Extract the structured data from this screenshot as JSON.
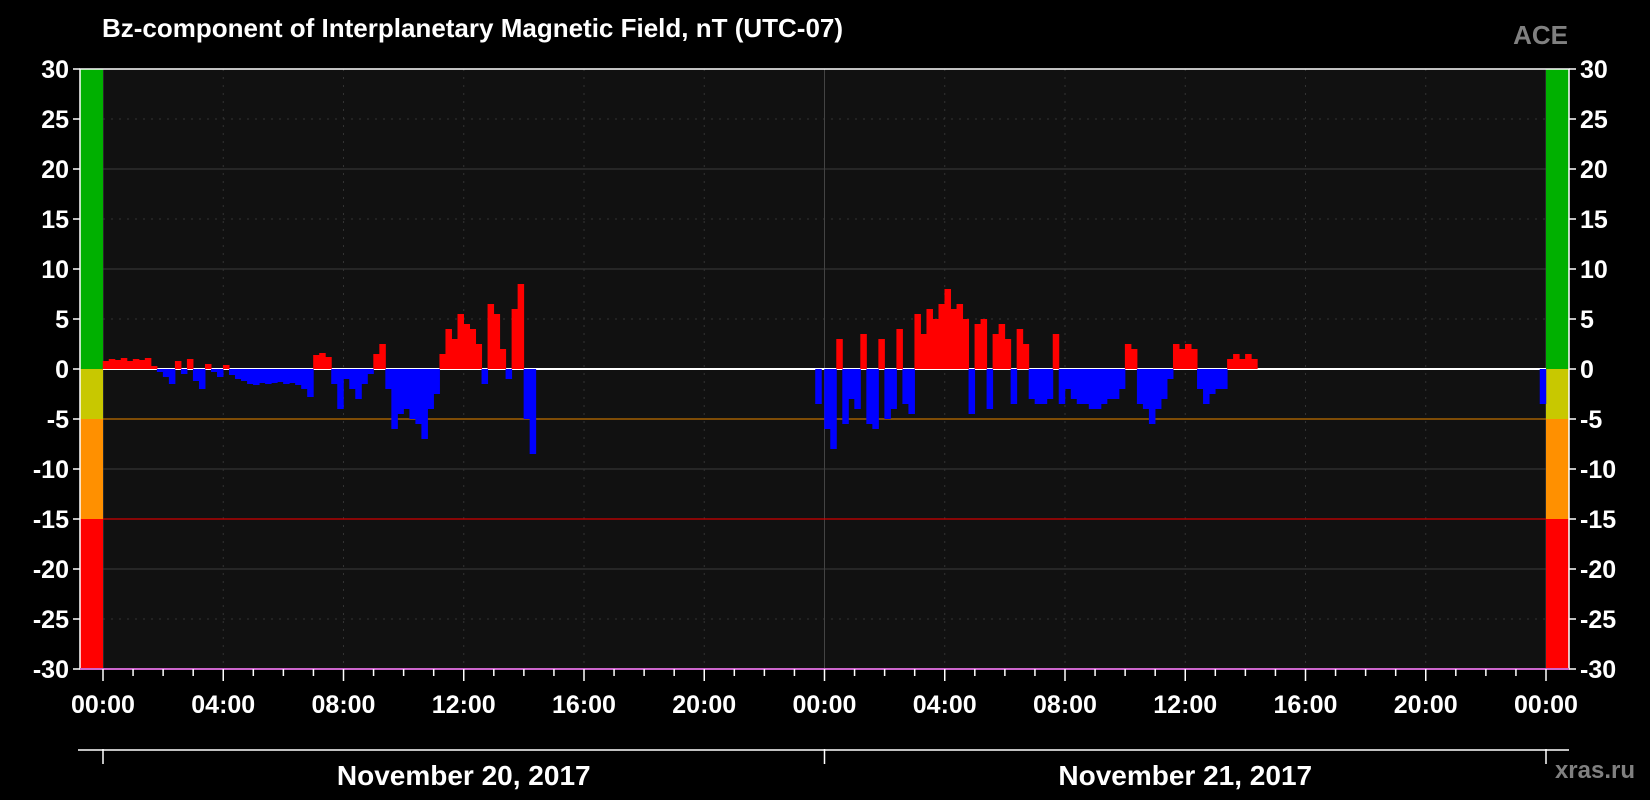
{
  "chart_data": {
    "type": "bar",
    "title": "Bz-component of Interplanetary Magnetic Field, nT (UTC-07)",
    "source_label": "ACE",
    "watermark": "xras.ru",
    "ylim": [
      -30,
      30
    ],
    "y_ticks": [
      30,
      25,
      20,
      15,
      10,
      5,
      0,
      -5,
      -10,
      -15,
      -20,
      -25,
      -30
    ],
    "xlim_hours": [
      0,
      48
    ],
    "x_ticks": [
      {
        "h": 0,
        "label": "00:00"
      },
      {
        "h": 4,
        "label": "04:00"
      },
      {
        "h": 8,
        "label": "08:00"
      },
      {
        "h": 12,
        "label": "12:00"
      },
      {
        "h": 16,
        "label": "16:00"
      },
      {
        "h": 20,
        "label": "20:00"
      },
      {
        "h": 24,
        "label": "00:00"
      },
      {
        "h": 28,
        "label": "04:00"
      },
      {
        "h": 32,
        "label": "08:00"
      },
      {
        "h": 36,
        "label": "12:00"
      },
      {
        "h": 40,
        "label": "16:00"
      },
      {
        "h": 44,
        "label": "20:00"
      },
      {
        "h": 48,
        "label": "00:00"
      }
    ],
    "dates": [
      {
        "label": "November 20, 2017",
        "start_h": 0
      },
      {
        "label": "November 21, 2017",
        "start_h": 24
      }
    ],
    "thresholds": [
      {
        "value": 0,
        "color": "#ffffff"
      },
      {
        "value": -5,
        "color": "#c07000"
      },
      {
        "value": -15,
        "color": "#d00000"
      }
    ],
    "scale_bands": [
      {
        "from": 30,
        "to": 0,
        "color": "#00b000"
      },
      {
        "from": 0,
        "to": -5,
        "color": "#c8c800"
      },
      {
        "from": -5,
        "to": -15,
        "color": "#ff9000"
      },
      {
        "from": -15,
        "to": -30,
        "color": "#ff0000"
      }
    ],
    "colors": {
      "positive": "#ff0000",
      "negative": "#0000ff"
    },
    "series": [
      {
        "x_hours": [
          0.1,
          0.3,
          0.5,
          0.7,
          0.9,
          1.1,
          1.3,
          1.5,
          1.7,
          1.9,
          2.1,
          2.3,
          2.5,
          2.7,
          2.9,
          3.1,
          3.3,
          3.5,
          3.7,
          3.9,
          4.1,
          4.3,
          4.5,
          4.7,
          4.9,
          5.1,
          5.3,
          5.5,
          5.7,
          5.9,
          6.1,
          6.3,
          6.5,
          6.7,
          6.9,
          7.1,
          7.3,
          7.5,
          7.7,
          7.9,
          8.1,
          8.3,
          8.5,
          8.7,
          8.9,
          9.1,
          9.3,
          9.5,
          9.7,
          9.9,
          10.1,
          10.3,
          10.5,
          10.7,
          10.9,
          11.1,
          11.3,
          11.5,
          11.7,
          11.9,
          12.1,
          12.3,
          12.5,
          12.7,
          12.9,
          13.1,
          13.3,
          13.5,
          13.7,
          13.9,
          14.1,
          14.3
        ],
        "values": [
          0.8,
          1.0,
          0.9,
          1.1,
          0.8,
          1.0,
          0.9,
          1.1,
          0.3,
          -0.3,
          -0.8,
          -1.5,
          0.8,
          -0.5,
          1.0,
          -1.2,
          -2.0,
          0.5,
          -0.3,
          -0.8,
          0.4,
          -0.6,
          -1.0,
          -1.2,
          -1.5,
          -1.6,
          -1.4,
          -1.5,
          -1.4,
          -1.3,
          -1.5,
          -1.4,
          -1.6,
          -2.0,
          -2.8,
          1.4,
          1.6,
          1.2,
          -1.5,
          -4.0,
          -1.0,
          -2.0,
          -3.0,
          -1.5,
          -0.5,
          1.5,
          2.5,
          -2.0,
          -6.0,
          -4.5,
          -4.0,
          -5.0,
          -5.5,
          -7.0,
          -4.0,
          -2.5,
          1.5,
          4.0,
          3.0,
          5.5,
          4.5,
          4.0,
          2.5,
          -1.5,
          6.5,
          5.5,
          2.0,
          -1.0,
          6.0,
          8.5,
          -5.0,
          -8.5
        ]
      },
      {
        "x_hours": [
          23.8,
          24.1,
          24.3,
          24.5,
          24.7,
          24.9,
          25.1,
          25.3,
          25.5,
          25.7,
          25.9,
          26.1,
          26.3,
          26.5,
          26.7,
          26.9,
          27.1,
          27.3,
          27.5,
          27.7,
          27.9,
          28.1,
          28.3,
          28.5,
          28.7,
          28.9,
          29.1,
          29.3,
          29.5,
          29.7,
          29.9,
          30.1,
          30.3,
          30.5,
          30.7,
          30.9,
          31.1,
          31.3,
          31.5,
          31.7,
          31.9,
          32.1,
          32.3,
          32.5,
          32.7,
          32.9,
          33.1,
          33.3,
          33.5,
          33.7,
          33.9,
          34.1,
          34.3,
          34.5,
          34.7,
          34.9,
          35.1,
          35.3,
          35.5,
          35.7,
          35.9,
          36.1,
          36.3,
          36.5,
          36.7,
          36.9,
          37.1,
          37.3,
          37.5,
          37.7,
          37.9,
          38.1,
          38.3,
          38.5,
          38.7,
          38.9,
          47.9
        ],
        "values": [
          -3.5,
          -6.0,
          -8.0,
          3.0,
          -5.5,
          -3.0,
          -4.0,
          3.5,
          -5.5,
          -6.0,
          3.0,
          -5.0,
          -4.0,
          4.0,
          -3.5,
          -4.5,
          5.5,
          3.5,
          6.0,
          5.0,
          6.5,
          8.0,
          6.0,
          6.5,
          5.0,
          -4.5,
          4.5,
          5.0,
          -4.0,
          3.5,
          4.5,
          3.0,
          -3.5,
          4.0,
          2.5,
          -3.0,
          -3.5,
          -3.5,
          -3.0,
          3.5,
          -3.5,
          -2.0,
          -3.0,
          -3.5,
          -3.5,
          -4.0,
          -4.0,
          -3.5,
          -3.0,
          -3.0,
          -2.0,
          2.5,
          2.0,
          -3.5,
          -4.0,
          -5.5,
          -4.0,
          -3.0,
          -1.0,
          2.5,
          2.0,
          2.5,
          2.0,
          -2.0,
          -3.5,
          -2.5,
          -2.0,
          -2.0,
          1.0,
          1.5,
          1.0,
          1.5,
          1.0,
          0.0,
          0.0,
          0.0,
          -3.5
        ]
      }
    ]
  }
}
